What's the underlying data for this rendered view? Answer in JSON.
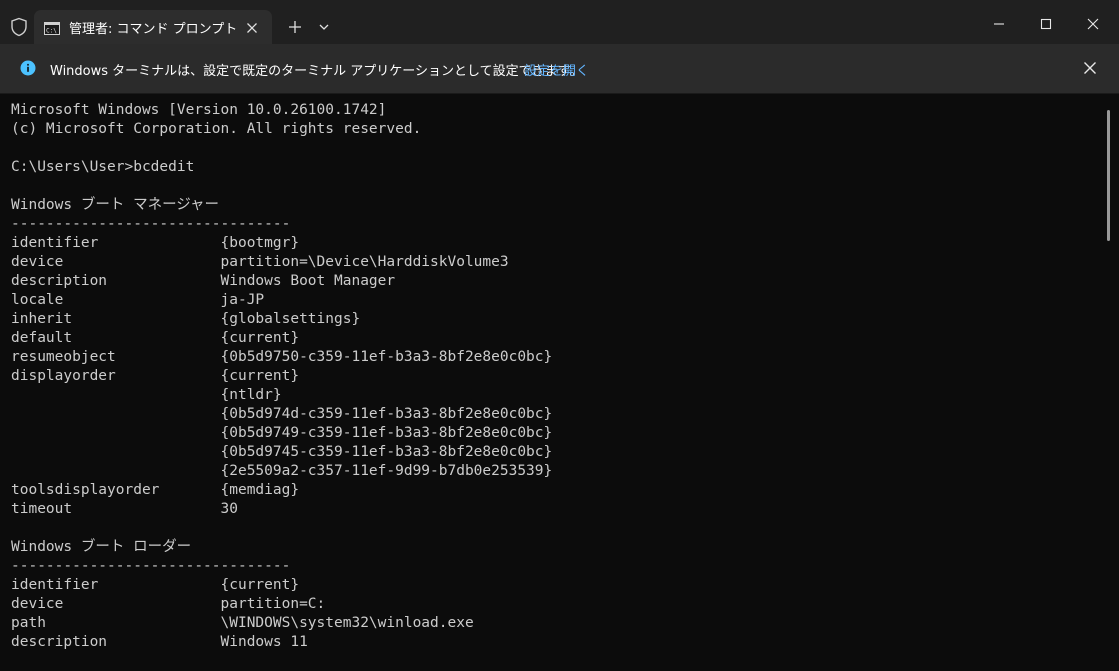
{
  "tab": {
    "title": "管理者: コマンド プロンプト"
  },
  "infobar": {
    "message": "Windows ターミナルは、設定で既定のターミナル アプリケーションとして設定できます。",
    "link": "設定を開く"
  },
  "terminal": {
    "lines": [
      "Microsoft Windows [Version 10.0.26100.1742]",
      "(c) Microsoft Corporation. All rights reserved.",
      "",
      "C:\\Users\\User>bcdedit",
      "",
      "Windows ブート マネージャー",
      "--------------------------------",
      "identifier              {bootmgr}",
      "device                  partition=\\Device\\HarddiskVolume3",
      "description             Windows Boot Manager",
      "locale                  ja-JP",
      "inherit                 {globalsettings}",
      "default                 {current}",
      "resumeobject            {0b5d9750-c359-11ef-b3a3-8bf2e8e0c0bc}",
      "displayorder            {current}",
      "                        {ntldr}",
      "                        {0b5d974d-c359-11ef-b3a3-8bf2e8e0c0bc}",
      "                        {0b5d9749-c359-11ef-b3a3-8bf2e8e0c0bc}",
      "                        {0b5d9745-c359-11ef-b3a3-8bf2e8e0c0bc}",
      "                        {2e5509a2-c357-11ef-9d99-b7db0e253539}",
      "toolsdisplayorder       {memdiag}",
      "timeout                 30",
      "",
      "Windows ブート ローダー",
      "--------------------------------",
      "identifier              {current}",
      "device                  partition=C:",
      "path                    \\WINDOWS\\system32\\winload.exe",
      "description             Windows 11"
    ]
  },
  "colors": {
    "titlebar": "#202020",
    "tab": "#2d2d2d",
    "infobar": "#2b2b2b",
    "terminal_bg": "#0c0c0c",
    "terminal_fg": "#cccccc",
    "info_icon": "#4cc2ff",
    "link": "#62b5ff"
  },
  "icons": {
    "shield": "shield-icon",
    "tab": "cmd-icon",
    "info": "info-icon"
  }
}
